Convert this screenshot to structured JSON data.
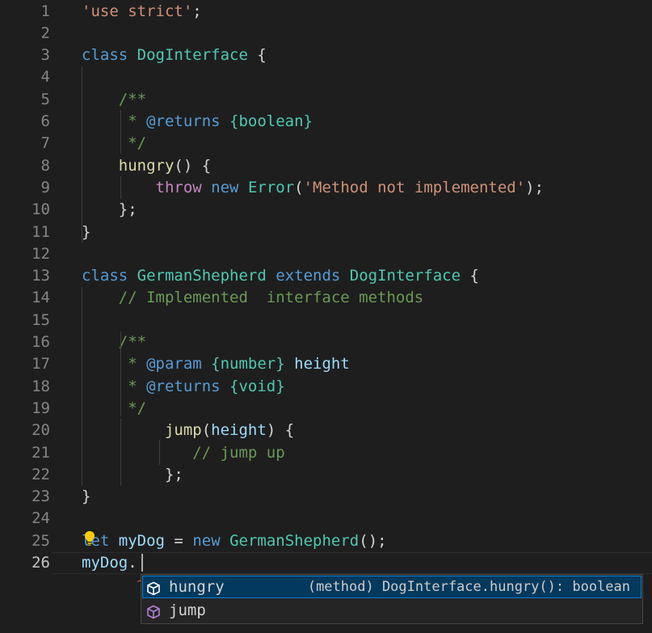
{
  "editor": {
    "lines": [
      {
        "n": "1",
        "tokens": [
          {
            "t": "'use strict'",
            "c": "str"
          },
          {
            "t": ";",
            "c": "pun"
          }
        ]
      },
      {
        "n": "2",
        "tokens": []
      },
      {
        "n": "3",
        "tokens": [
          {
            "t": "class ",
            "c": "kw"
          },
          {
            "t": "DogInterface",
            "c": "cls"
          },
          {
            "t": " {",
            "c": "pun"
          }
        ]
      },
      {
        "n": "4",
        "tokens": []
      },
      {
        "n": "5",
        "tokens": [
          {
            "t": "    /**",
            "c": "cmt"
          }
        ]
      },
      {
        "n": "6",
        "tokens": [
          {
            "t": "     * ",
            "c": "cmt"
          },
          {
            "t": "@returns",
            "c": "tag"
          },
          {
            "t": " ",
            "c": "cmt"
          },
          {
            "t": "{boolean}",
            "c": "cls"
          }
        ]
      },
      {
        "n": "7",
        "tokens": [
          {
            "t": "     */",
            "c": "cmt"
          }
        ]
      },
      {
        "n": "8",
        "tokens": [
          {
            "t": "    ",
            "c": "pun"
          },
          {
            "t": "hungry",
            "c": "fn"
          },
          {
            "t": "() {",
            "c": "pun"
          }
        ]
      },
      {
        "n": "9",
        "tokens": [
          {
            "t": "        ",
            "c": "pun"
          },
          {
            "t": "throw",
            "c": "ctl"
          },
          {
            "t": " ",
            "c": "pun"
          },
          {
            "t": "new",
            "c": "kw"
          },
          {
            "t": " ",
            "c": "pun"
          },
          {
            "t": "Error",
            "c": "cls"
          },
          {
            "t": "(",
            "c": "pun"
          },
          {
            "t": "'Method not implemented'",
            "c": "str"
          },
          {
            "t": ");",
            "c": "pun"
          }
        ]
      },
      {
        "n": "10",
        "tokens": [
          {
            "t": "    };",
            "c": "pun"
          }
        ]
      },
      {
        "n": "11",
        "tokens": [
          {
            "t": "}",
            "c": "pun"
          }
        ]
      },
      {
        "n": "12",
        "tokens": []
      },
      {
        "n": "13",
        "tokens": [
          {
            "t": "class ",
            "c": "kw"
          },
          {
            "t": "GermanShepherd",
            "c": "cls"
          },
          {
            "t": " ",
            "c": "pun"
          },
          {
            "t": "extends",
            "c": "kw"
          },
          {
            "t": " ",
            "c": "pun"
          },
          {
            "t": "DogInterface",
            "c": "cls"
          },
          {
            "t": " {",
            "c": "pun"
          }
        ]
      },
      {
        "n": "14",
        "tokens": [
          {
            "t": "    // Implemented  interface methods",
            "c": "cmt"
          }
        ]
      },
      {
        "n": "15",
        "tokens": []
      },
      {
        "n": "16",
        "tokens": [
          {
            "t": "    /**",
            "c": "cmt"
          }
        ]
      },
      {
        "n": "17",
        "tokens": [
          {
            "t": "     * ",
            "c": "cmt"
          },
          {
            "t": "@param",
            "c": "tag"
          },
          {
            "t": " ",
            "c": "cmt"
          },
          {
            "t": "{number}",
            "c": "cls"
          },
          {
            "t": " ",
            "c": "cmt"
          },
          {
            "t": "height",
            "c": "var"
          }
        ]
      },
      {
        "n": "18",
        "tokens": [
          {
            "t": "     * ",
            "c": "cmt"
          },
          {
            "t": "@returns",
            "c": "tag"
          },
          {
            "t": " ",
            "c": "cmt"
          },
          {
            "t": "{void}",
            "c": "cls"
          }
        ]
      },
      {
        "n": "19",
        "tokens": [
          {
            "t": "     */",
            "c": "cmt"
          }
        ]
      },
      {
        "n": "20",
        "tokens": [
          {
            "t": "         ",
            "c": "pun"
          },
          {
            "t": "jump",
            "c": "fn"
          },
          {
            "t": "(",
            "c": "pun"
          },
          {
            "t": "height",
            "c": "par"
          },
          {
            "t": ") {",
            "c": "pun"
          }
        ]
      },
      {
        "n": "21",
        "tokens": [
          {
            "t": "            // jump up",
            "c": "cmt"
          }
        ]
      },
      {
        "n": "22",
        "tokens": [
          {
            "t": "         };",
            "c": "pun"
          }
        ]
      },
      {
        "n": "23",
        "tokens": [
          {
            "t": "}",
            "c": "pun"
          }
        ]
      },
      {
        "n": "24",
        "tokens": []
      },
      {
        "n": "25",
        "tokens": [
          {
            "t": "let",
            "c": "kw"
          },
          {
            "t": " ",
            "c": "pun"
          },
          {
            "t": "myDog",
            "c": "var"
          },
          {
            "t": " = ",
            "c": "pun"
          },
          {
            "t": "new",
            "c": "kw"
          },
          {
            "t": " ",
            "c": "pun"
          },
          {
            "t": "GermanShepherd",
            "c": "cls"
          },
          {
            "t": "();",
            "c": "pun"
          }
        ]
      },
      {
        "n": "26",
        "tokens": [
          {
            "t": "myDog",
            "c": "var"
          },
          {
            "t": ".",
            "c": "pun"
          }
        ],
        "active": true
      }
    ]
  },
  "suggest": {
    "items": [
      {
        "label": "hungry",
        "detail": "(method) DogInterface.hungry(): boolean",
        "icon": "method-cube-icon",
        "selected": true
      },
      {
        "label": "jump",
        "detail": "",
        "icon": "method-cube-icon",
        "selected": false
      }
    ]
  },
  "colors": {
    "background": "#1e1e1e",
    "selection": "#04395e",
    "method_icon_selected": "#75beff",
    "method_icon": "#b180d7"
  }
}
